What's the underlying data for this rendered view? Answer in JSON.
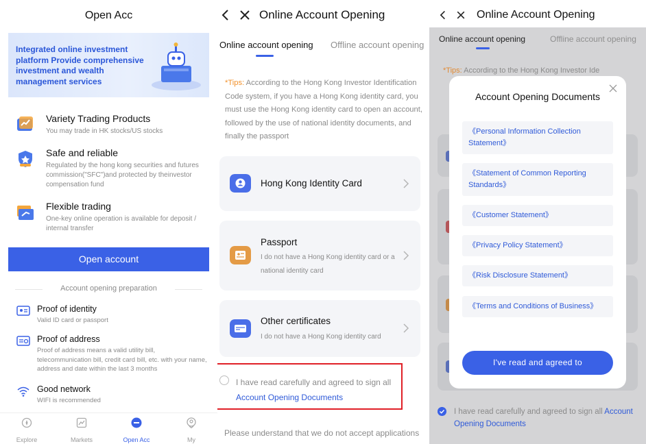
{
  "colors": {
    "accent": "#3a61e6",
    "link": "#2f5ad8",
    "tip": "#f2912b",
    "highlight_box": "#e01f26"
  },
  "panel1": {
    "title": "Open Acc",
    "banner_text": "Integrated online investment platform Provide comprehensive investment and wealth management services",
    "features": [
      {
        "icon": "chart-trend-icon",
        "title": "Variety Trading Products",
        "desc": "You may trade in HK stocks/US stocks"
      },
      {
        "icon": "shield-star-icon",
        "title": "Safe and reliable",
        "desc": "Regulated by the hong kong securities and futures commission(\"SFC\")and protected by theinvestor compensation fund"
      },
      {
        "icon": "folder-arrow-icon",
        "title": "Flexible trading",
        "desc": "One-key online operation is available for deposit / internal transfer"
      }
    ],
    "open_button": "Open account",
    "prep_header": "Account opening preparation",
    "prep_items": [
      {
        "icon": "id-card-icon",
        "title": "Proof of identity",
        "desc": "Valid ID card or passport"
      },
      {
        "icon": "address-card-icon",
        "title": "Proof of address",
        "desc": "Proof of address means a valid utility bill, telecommunication bill, credit card bill, etc. with your name, address and date within the last 3 months"
      },
      {
        "icon": "wifi-icon",
        "title": "Good network",
        "desc": "WIFI is recommended"
      }
    ],
    "tabs": [
      {
        "label": "Explore",
        "icon": "compass-icon"
      },
      {
        "label": "Markets",
        "icon": "chart-icon"
      },
      {
        "label": "Open Acc",
        "icon": "open-acc-icon",
        "active": true
      },
      {
        "label": "My",
        "icon": "user-icon"
      }
    ]
  },
  "panel2": {
    "title": "Online Account Opening",
    "tab_online": "Online account opening",
    "tab_offline": "Offline account opening",
    "tips_label": "*Tips:",
    "tips_text": " According to the Hong Kong Investor Identification Code system, if you have a Hong Kong identity card, you must use the Hong Kong identity card to open an account, followed by the use of national identity documents, and finally the passport",
    "cards": [
      {
        "icon": "id-person-icon",
        "title": "Hong Kong Identity Card",
        "desc": ""
      },
      {
        "icon": "passport-icon",
        "title": "Passport",
        "desc": "I do not have a Hong Kong identity card or a national identity card"
      },
      {
        "icon": "certificate-icon",
        "title": "Other certificates",
        "desc": "I do not have a Hong Kong identity card"
      }
    ],
    "agree_text": "I have read carefully and agreed to sign all ",
    "agree_link": "Account Opening Documents",
    "footer_note": "Please understand that we do not accept applications"
  },
  "panel3": {
    "title": "Online Account Opening",
    "tab_online": "Online account opening",
    "tab_offline": "Offline account opening",
    "tips_label": "*Tips:",
    "tips_text": " According to the Hong Kong Investor Ide",
    "modal_title": "Account Opening Documents",
    "documents": [
      "《Personal Information Collection Statement》",
      "《Statement of Common Reporting Standards》",
      "《Customer Statement》",
      "《Privacy Policy Statement》",
      "《Risk Disclosure Statement》",
      "《Terms and Conditions of Business》"
    ],
    "modal_button": "I've read and agreed to",
    "agree_text": "I have read carefully and agreed to sign all ",
    "agree_link": "Account Opening Documents"
  }
}
